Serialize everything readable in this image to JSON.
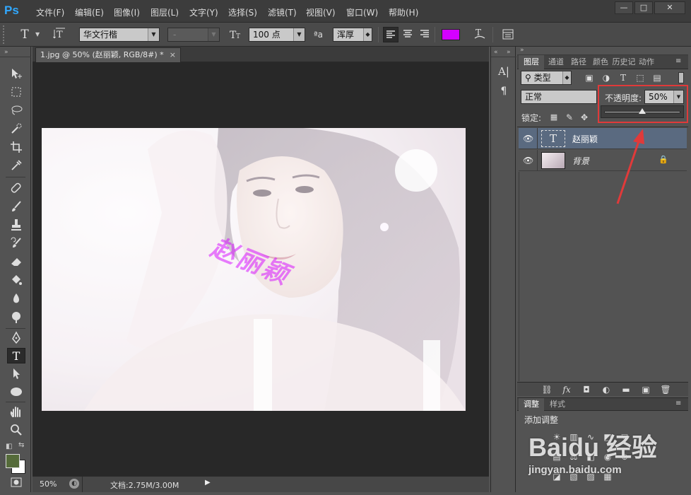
{
  "app": {
    "logo": "Ps",
    "menu": [
      "文件(F)",
      "编辑(E)",
      "图像(I)",
      "图层(L)",
      "文字(Y)",
      "选择(S)",
      "滤镜(T)",
      "视图(V)",
      "窗口(W)",
      "帮助(H)"
    ],
    "window_buttons": [
      "—",
      "□",
      "✕"
    ]
  },
  "options": {
    "tool_glyph": "T",
    "font_family": "华文行楷",
    "font_style": "-",
    "font_size": "100 点",
    "aa_prefix": "ªa",
    "anti_alias": "浑厚",
    "text_color": "#d400ff"
  },
  "document": {
    "tab_label": "1.jpg @ 50% (赵丽颖, RGB/8#) *",
    "close_glyph": "×",
    "overlay_text": "赵丽颖"
  },
  "status": {
    "zoom": "50%",
    "doc_info": "文档:2.75M/3.00M"
  },
  "layers_panel": {
    "tabs": [
      "图层",
      "通道",
      "路径",
      "颜色",
      "历史记",
      "动作"
    ],
    "filter_kind": "类型",
    "blend_mode": "正常",
    "opacity_label": "不透明度:",
    "opacity_value": "50%",
    "opacity_fraction": 0.5,
    "lock_label": "锁定:",
    "layers": [
      {
        "name": "赵丽颖",
        "type": "text",
        "selected": true
      },
      {
        "name": "背景",
        "type": "image",
        "selected": false
      }
    ]
  },
  "adjust_panel": {
    "tabs": [
      "调整",
      "样式"
    ],
    "heading": "添加调整"
  },
  "watermark": {
    "brand": "Baidu 经验",
    "url": "jingyan.baidu.com"
  },
  "colors": {
    "accent": "#31a8ff",
    "annotation": "#e03a3a",
    "foreground": "#556b3a",
    "background": "#ffffff"
  }
}
